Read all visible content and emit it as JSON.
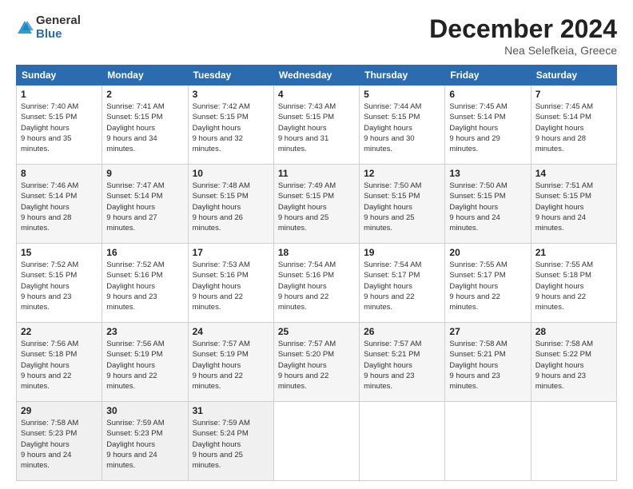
{
  "header": {
    "logo_general": "General",
    "logo_blue": "Blue",
    "month_title": "December 2024",
    "location": "Nea Selefkeia, Greece"
  },
  "days_of_week": [
    "Sunday",
    "Monday",
    "Tuesday",
    "Wednesday",
    "Thursday",
    "Friday",
    "Saturday"
  ],
  "weeks": [
    [
      {
        "day": 1,
        "sunrise": "7:40 AM",
        "sunset": "5:15 PM",
        "daylight": "9 hours and 35 minutes."
      },
      {
        "day": 2,
        "sunrise": "7:41 AM",
        "sunset": "5:15 PM",
        "daylight": "9 hours and 34 minutes."
      },
      {
        "day": 3,
        "sunrise": "7:42 AM",
        "sunset": "5:15 PM",
        "daylight": "9 hours and 32 minutes."
      },
      {
        "day": 4,
        "sunrise": "7:43 AM",
        "sunset": "5:15 PM",
        "daylight": "9 hours and 31 minutes."
      },
      {
        "day": 5,
        "sunrise": "7:44 AM",
        "sunset": "5:15 PM",
        "daylight": "9 hours and 30 minutes."
      },
      {
        "day": 6,
        "sunrise": "7:45 AM",
        "sunset": "5:14 PM",
        "daylight": "9 hours and 29 minutes."
      },
      {
        "day": 7,
        "sunrise": "7:45 AM",
        "sunset": "5:14 PM",
        "daylight": "9 hours and 28 minutes."
      }
    ],
    [
      {
        "day": 8,
        "sunrise": "7:46 AM",
        "sunset": "5:14 PM",
        "daylight": "9 hours and 28 minutes."
      },
      {
        "day": 9,
        "sunrise": "7:47 AM",
        "sunset": "5:14 PM",
        "daylight": "9 hours and 27 minutes."
      },
      {
        "day": 10,
        "sunrise": "7:48 AM",
        "sunset": "5:15 PM",
        "daylight": "9 hours and 26 minutes."
      },
      {
        "day": 11,
        "sunrise": "7:49 AM",
        "sunset": "5:15 PM",
        "daylight": "9 hours and 25 minutes."
      },
      {
        "day": 12,
        "sunrise": "7:50 AM",
        "sunset": "5:15 PM",
        "daylight": "9 hours and 25 minutes."
      },
      {
        "day": 13,
        "sunrise": "7:50 AM",
        "sunset": "5:15 PM",
        "daylight": "9 hours and 24 minutes."
      },
      {
        "day": 14,
        "sunrise": "7:51 AM",
        "sunset": "5:15 PM",
        "daylight": "9 hours and 24 minutes."
      }
    ],
    [
      {
        "day": 15,
        "sunrise": "7:52 AM",
        "sunset": "5:15 PM",
        "daylight": "9 hours and 23 minutes."
      },
      {
        "day": 16,
        "sunrise": "7:52 AM",
        "sunset": "5:16 PM",
        "daylight": "9 hours and 23 minutes."
      },
      {
        "day": 17,
        "sunrise": "7:53 AM",
        "sunset": "5:16 PM",
        "daylight": "9 hours and 22 minutes."
      },
      {
        "day": 18,
        "sunrise": "7:54 AM",
        "sunset": "5:16 PM",
        "daylight": "9 hours and 22 minutes."
      },
      {
        "day": 19,
        "sunrise": "7:54 AM",
        "sunset": "5:17 PM",
        "daylight": "9 hours and 22 minutes."
      },
      {
        "day": 20,
        "sunrise": "7:55 AM",
        "sunset": "5:17 PM",
        "daylight": "9 hours and 22 minutes."
      },
      {
        "day": 21,
        "sunrise": "7:55 AM",
        "sunset": "5:18 PM",
        "daylight": "9 hours and 22 minutes."
      }
    ],
    [
      {
        "day": 22,
        "sunrise": "7:56 AM",
        "sunset": "5:18 PM",
        "daylight": "9 hours and 22 minutes."
      },
      {
        "day": 23,
        "sunrise": "7:56 AM",
        "sunset": "5:19 PM",
        "daylight": "9 hours and 22 minutes."
      },
      {
        "day": 24,
        "sunrise": "7:57 AM",
        "sunset": "5:19 PM",
        "daylight": "9 hours and 22 minutes."
      },
      {
        "day": 25,
        "sunrise": "7:57 AM",
        "sunset": "5:20 PM",
        "daylight": "9 hours and 22 minutes."
      },
      {
        "day": 26,
        "sunrise": "7:57 AM",
        "sunset": "5:21 PM",
        "daylight": "9 hours and 23 minutes."
      },
      {
        "day": 27,
        "sunrise": "7:58 AM",
        "sunset": "5:21 PM",
        "daylight": "9 hours and 23 minutes."
      },
      {
        "day": 28,
        "sunrise": "7:58 AM",
        "sunset": "5:22 PM",
        "daylight": "9 hours and 23 minutes."
      }
    ],
    [
      {
        "day": 29,
        "sunrise": "7:58 AM",
        "sunset": "5:23 PM",
        "daylight": "9 hours and 24 minutes."
      },
      {
        "day": 30,
        "sunrise": "7:59 AM",
        "sunset": "5:23 PM",
        "daylight": "9 hours and 24 minutes."
      },
      {
        "day": 31,
        "sunrise": "7:59 AM",
        "sunset": "5:24 PM",
        "daylight": "9 hours and 25 minutes."
      },
      null,
      null,
      null,
      null
    ]
  ]
}
